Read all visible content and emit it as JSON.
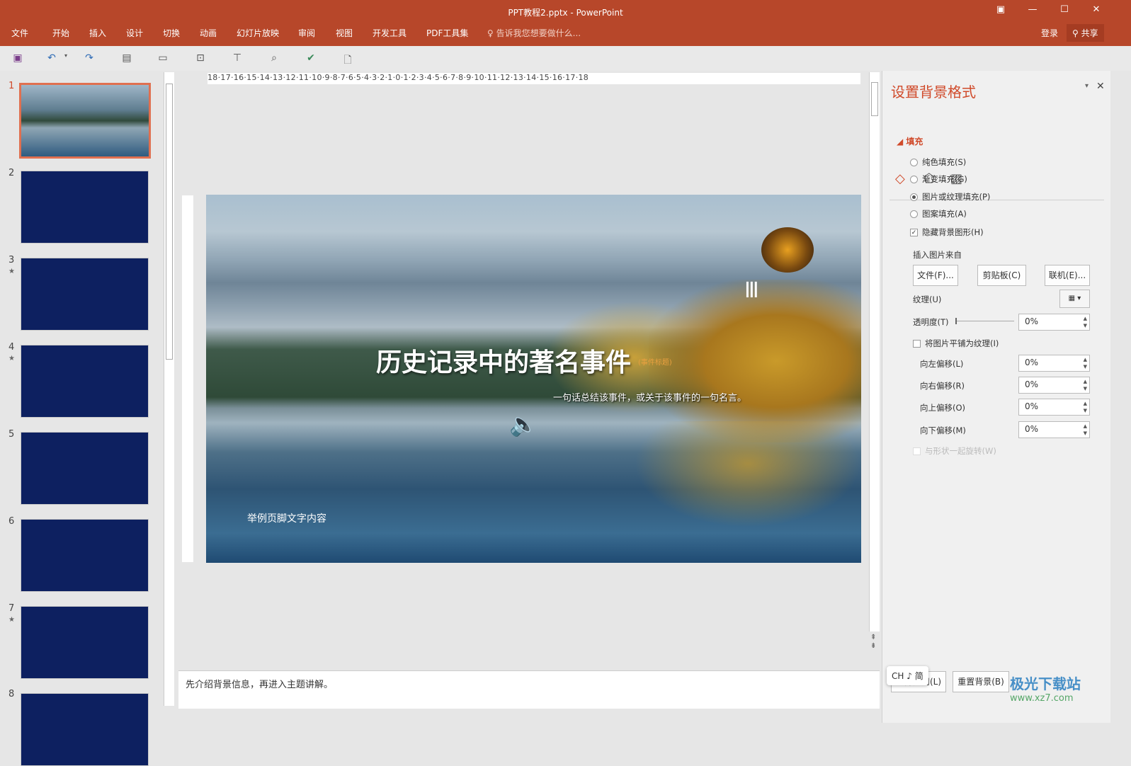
{
  "window": {
    "title": "PPT教程2.pptx - PowerPoint",
    "login": "登录",
    "share": "共享"
  },
  "menu": [
    "文件",
    "开始",
    "插入",
    "设计",
    "切换",
    "动画",
    "幻灯片放映",
    "审阅",
    "视图",
    "开发工具",
    "PDF工具集"
  ],
  "tellme": "告诉我您想要做什么...",
  "thumbnails": [
    {
      "num": "1",
      "star": ""
    },
    {
      "num": "2",
      "star": ""
    },
    {
      "num": "3",
      "star": "★"
    },
    {
      "num": "4",
      "star": "★"
    },
    {
      "num": "5",
      "star": ""
    },
    {
      "num": "6",
      "star": ""
    },
    {
      "num": "7",
      "star": "★"
    },
    {
      "num": "8",
      "star": ""
    }
  ],
  "ruler": "18·17·16·15·14·13·12·11·10·9·8·7·6·5·4·3·2·1·0·1·2·3·4·5·6·7·8·9·10·11·12·13·14·15·16·17·18",
  "slide": {
    "title": "历史记录中的著名事件",
    "title_note": "(事件标题)",
    "subtitle": "一句话总结该事件，或关于该事件的一句名言。",
    "footer": "举例页脚文字内容"
  },
  "notes": "先介绍背景信息，再进入主题讲解。",
  "pane": {
    "title": "设置背景格式",
    "section": "填充",
    "options": [
      {
        "label": "纯色填充(S)",
        "checked": false
      },
      {
        "label": "渐变填充(G)",
        "checked": false
      },
      {
        "label": "图片或纹理填充(P)",
        "checked": true
      },
      {
        "label": "图案填充(A)",
        "checked": false
      }
    ],
    "hide_bg": "隐藏背景图形(H)",
    "insert_from": "插入图片来自",
    "btn_file": "文件(F)...",
    "btn_clip": "剪贴板(C)",
    "btn_online": "联机(E)...",
    "texture": "纹理(U)",
    "transparency": "透明度(T)",
    "transparency_value": "0%",
    "tile": "将图片平铺为纹理(I)",
    "offsets": [
      {
        "label": "向左偏移(L)",
        "value": "0%"
      },
      {
        "label": "向右偏移(R)",
        "value": "0%"
      },
      {
        "label": "向上偏移(O)",
        "value": "0%"
      },
      {
        "label": "向下偏移(M)",
        "value": "0%"
      }
    ],
    "rotate": "与形状一起旋转(W)",
    "apply_all": "全部应用(L)",
    "reset": "重置背景(B)"
  },
  "ime": "CH ♪ 简",
  "watermark": {
    "name": "极光下载站",
    "url": "www.xz7.com"
  }
}
